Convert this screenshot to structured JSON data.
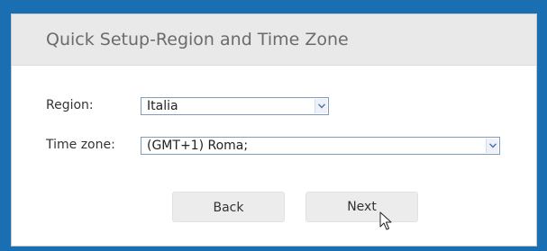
{
  "dialog": {
    "title": "Quick Setup-Region and Time Zone"
  },
  "region": {
    "label": "Region:",
    "value": "Italia"
  },
  "time_zone": {
    "label": "Time zone:",
    "value": "(GMT+1) Roma;"
  },
  "buttons": {
    "back_label": "Back",
    "next_label": "Next"
  },
  "colors": {
    "background": "#1a6fb3",
    "header": "#e9e9e9",
    "select_border": "#7f9db9",
    "button": "#ececec"
  },
  "icons": {
    "dropdown": "chevron-down-icon",
    "pointer": "mouse-pointer-icon"
  }
}
